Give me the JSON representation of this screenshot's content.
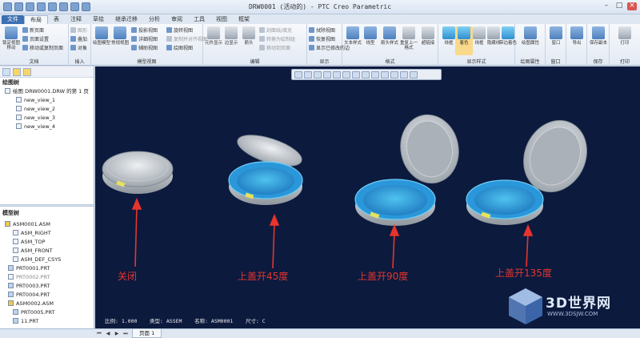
{
  "window": {
    "title": "DRW0001 (活动的) - PTC Creo Parametric"
  },
  "tabs": [
    "文件",
    "布局",
    "表",
    "注释",
    "草绘",
    "继承迁移",
    "分析",
    "审阅",
    "工具",
    "视图",
    "框架"
  ],
  "ribbon": {
    "doc": {
      "label": "文档",
      "btn1": "锁定视图移动",
      "s1": "新页面",
      "s2": "页面设置",
      "s3": "移动或复制页面"
    },
    "insert": {
      "label": "插入",
      "s1": "图形",
      "s2": "叠加",
      "s3": "对象"
    },
    "model": {
      "label": "模型视图",
      "b1": "绘图模型",
      "b2": "常规视图",
      "b3": "复制并对齐视图",
      "s1": "投影视图",
      "s2": "详细视图",
      "s3": "辅助视图",
      "s4": "旋转视图",
      "s5": "复制并对齐视图",
      "s6": "绘图视图"
    },
    "edit": {
      "label": "编辑",
      "b1": "元件显示",
      "b2": "边显示",
      "b3": "箭头",
      "s1": "剖面线/填充",
      "s2": "转换为绘制组",
      "s3": "移动到页面"
    },
    "display": {
      "label": "显示",
      "s1": "拭除视图",
      "s2": "恢复视图",
      "s3": "显示已修改的边"
    },
    "format": {
      "label": "格式",
      "b1": "文本样式",
      "b2": "线型",
      "b3": "箭头样式",
      "b4": "重复上一格式",
      "b5": "超链接"
    },
    "dispstyle": {
      "label": "显示样式",
      "b1": "线框",
      "b2": "着色",
      "b3": "线框",
      "b4": "隐藏线",
      "b5": "带边着色"
    },
    "props": {
      "label": "绘图属性",
      "b1": "绘图属性"
    },
    "window": {
      "label": "窗口",
      "b1": "窗口"
    },
    "export": {
      "b1": "导出"
    },
    "save": {
      "label": "保存",
      "b1": "保存副本"
    },
    "print": {
      "label": "打印",
      "b1": "打印"
    }
  },
  "drawing_tree": {
    "header": "绘图树",
    "root": "绘图 DRW0001.DRW 的第 1 页",
    "items": [
      "new_view_1",
      "new_view_2",
      "new_view_3",
      "new_view_4"
    ]
  },
  "model_tree": {
    "header": "模型树",
    "root": "ASM0001.ASM",
    "items": [
      "ASM_RIGHT",
      "ASM_TOP",
      "ASM_FRONT",
      "ASM_DEF_CSYS",
      "PRT0001.PRT",
      "PRT0002.PRT",
      "PRT0003.PRT",
      "PRT0004.PRT",
      "ASM0002.ASM",
      "PRT0005.PRT",
      "11.PRT"
    ]
  },
  "viewport": {
    "labels": [
      "关闭",
      "上盖开45度",
      "上盖开90度",
      "上盖开135度"
    ],
    "status": "比例: 1.000    类型: ASSEM    名称: ASM0001    尺寸: C"
  },
  "watermark": {
    "title": "3D世界网",
    "sub": "WWW.3DSJW.COM"
  },
  "bottombar": {
    "page_tab": "页面 1"
  },
  "colors": {
    "viewport_bg": "#0c1a3e",
    "label_red": "#e8342c",
    "case_blue": "#3aa7e0"
  }
}
